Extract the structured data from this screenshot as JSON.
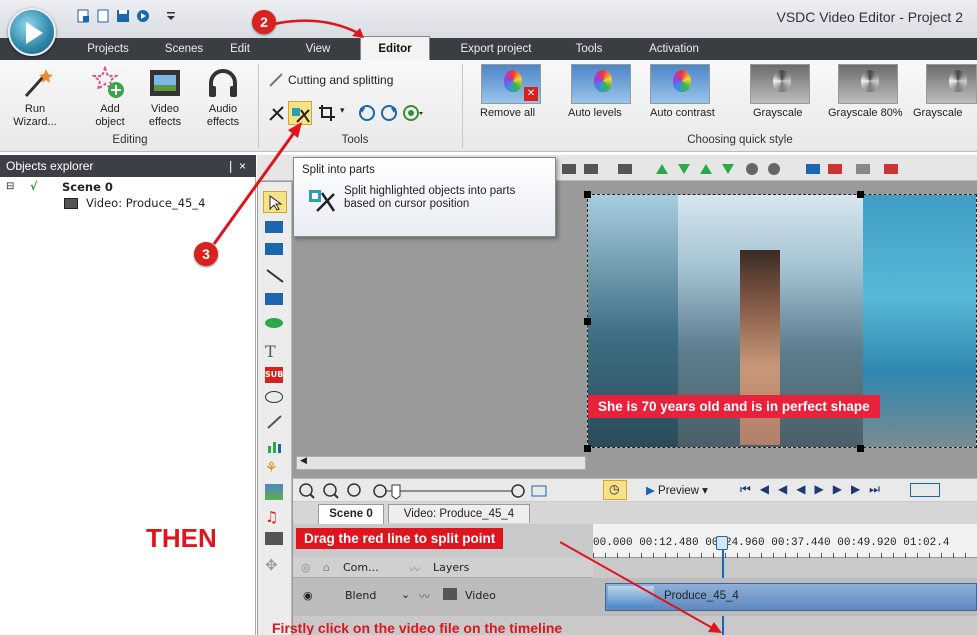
{
  "window": {
    "title": "VSDC Video Editor - Project 2"
  },
  "menu_tabs": [
    "Projects",
    "Scenes",
    "Edit",
    "View",
    "Editor",
    "Export project",
    "Tools",
    "Activation"
  ],
  "ribbon": {
    "editing": {
      "group_label": "Editing",
      "run_wizard": "Run\nWizard...",
      "add_object": "Add\nobject",
      "video_effects": "Video\neffects",
      "audio_effects": "Audio\neffects"
    },
    "tools": {
      "group_label": "Tools",
      "cutting": "Cutting and splitting"
    },
    "quick_style": {
      "group_label": "Choosing quick style",
      "items": [
        "Remove all",
        "Auto levels",
        "Auto contrast",
        "Grayscale",
        "Grayscale 80%",
        "Grayscale"
      ]
    }
  },
  "tooltip": {
    "title": "Split into parts",
    "body": "Split highlighted objects into parts based on cursor position"
  },
  "objects_explorer": {
    "title": "Objects explorer",
    "pin": "❘ ×",
    "scene": "Scene 0",
    "video": "Video: Produce_45_4"
  },
  "preview": {
    "caption": "She is 70 years old and is in perfect shape"
  },
  "timeline": {
    "preview_label": "Preview",
    "tabs": [
      "Scene 0",
      "Video: Produce_45_4"
    ],
    "ruler": "00.000  00:12.480  00:24.960  00:37.440  00:49.920  01:02.4",
    "header_com": "Com...",
    "header_layers": "Layers",
    "track_blend": "Blend",
    "track_type": "Video",
    "clip_name": "Produce_45_4"
  },
  "annotations": {
    "step2": "2",
    "step3": "3",
    "then": "THEN",
    "drag_hint": "Drag the red line to split point",
    "click_hint": "Firstly click on the video file on the timeline"
  },
  "colors": {
    "accent_red": "#e0141e",
    "tab_bar": "#3a3d42",
    "clip_blue": "#5f89bf"
  }
}
